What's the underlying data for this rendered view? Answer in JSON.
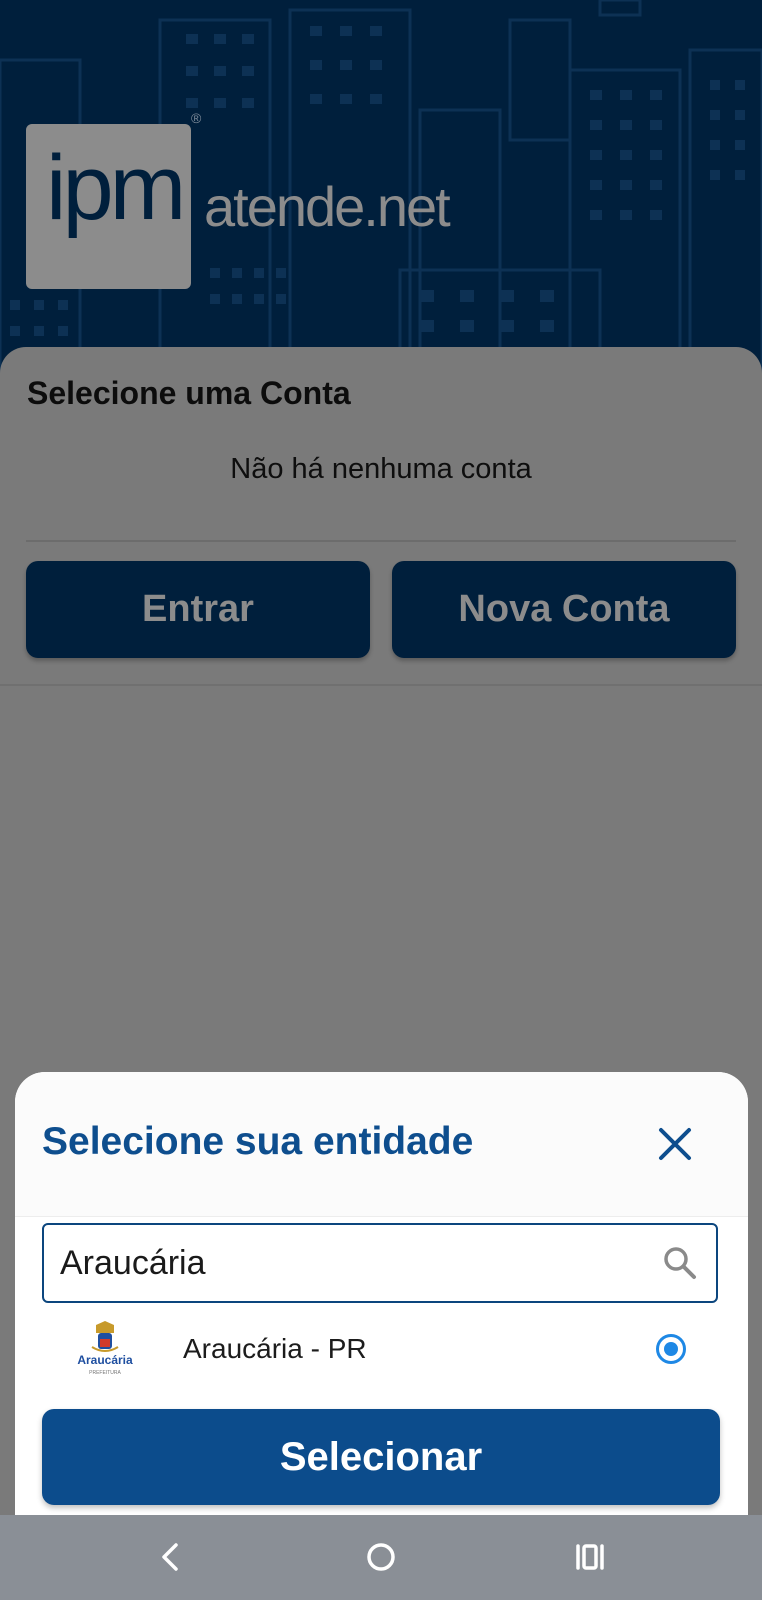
{
  "brand": {
    "logo_mark": "ipm",
    "registered_mark": "®",
    "name_main": "atende",
    "name_suffix": ".net"
  },
  "account_card": {
    "title": "Selecione uma Conta",
    "empty_message": "Não há nenhuma conta",
    "login_label": "Entrar",
    "new_account_label": "Nova Conta"
  },
  "entity_sheet": {
    "title": "Selecione sua entidade",
    "close_icon": "close-icon",
    "search": {
      "value": "Araucária",
      "icon": "search-icon"
    },
    "results": [
      {
        "name": "Araucária - PR",
        "logo_text": "Araucária",
        "logo_subtext": "PREFEITURA",
        "selected": true
      }
    ],
    "select_label": "Selecionar"
  },
  "nav_bar": {
    "back_icon": "back-icon",
    "home_icon": "home-icon",
    "recent_icon": "recent-apps-icon"
  },
  "colors": {
    "header_bg": "#001f3c",
    "dim_overlay": "#7a7a7a",
    "primary": "#0c4c8c",
    "title_blue": "#0e4e8e",
    "radio_blue": "#1e88e5"
  }
}
